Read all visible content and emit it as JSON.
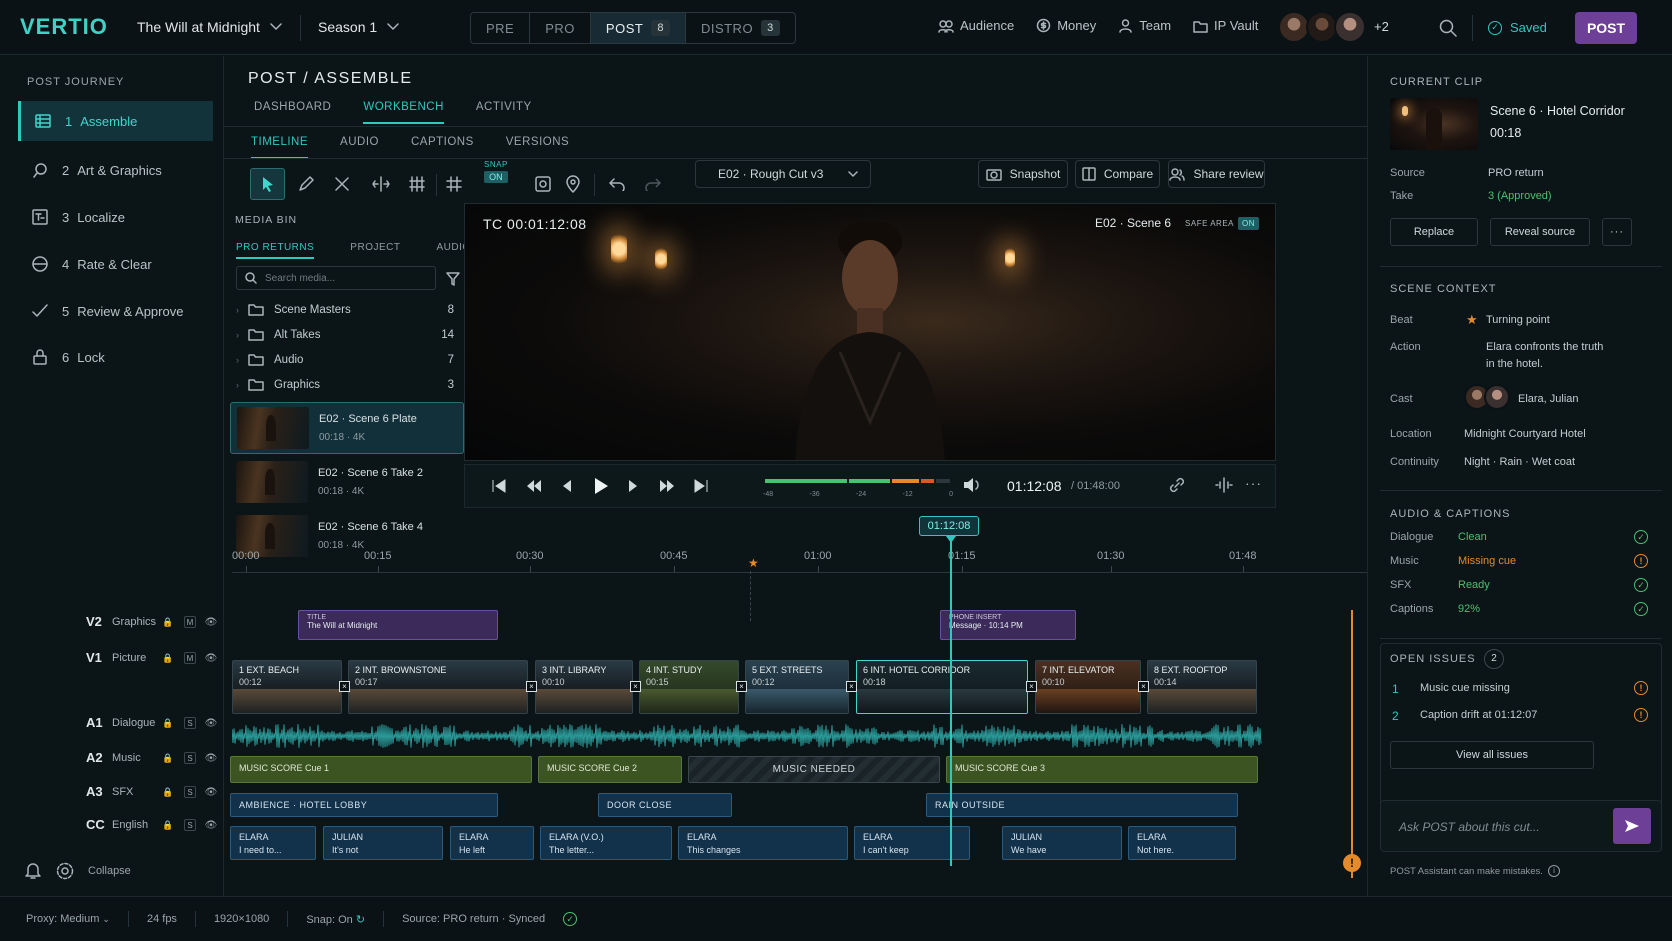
{
  "app": {
    "logo": "VERTIO",
    "project": "The Will at Midnight",
    "season": "Season 1"
  },
  "phases": [
    {
      "label": "PRE",
      "count": ""
    },
    {
      "label": "PRO",
      "count": ""
    },
    {
      "label": "POST",
      "count": "8"
    },
    {
      "label": "DISTRO",
      "count": "3"
    }
  ],
  "nav": {
    "audience": "Audience",
    "money": "Money",
    "team": "Team",
    "ipvault": "IP Vault",
    "more_people": "+2",
    "saved": "Saved",
    "post": "POST"
  },
  "left": {
    "heading": "POST JOURNEY",
    "items": [
      {
        "num": "1",
        "label": "Assemble"
      },
      {
        "num": "2",
        "label": "Art & Graphics"
      },
      {
        "num": "3",
        "label": "Localize"
      },
      {
        "num": "4",
        "label": "Rate & Clear"
      },
      {
        "num": "5",
        "label": "Review & Approve"
      },
      {
        "num": "6",
        "label": "Lock"
      }
    ],
    "collapse": "Collapse"
  },
  "center": {
    "breadcrumb": "POST  /  ASSEMBLE",
    "tabs": [
      "DASHBOARD",
      "WORKBENCH",
      "ACTIVITY"
    ],
    "subtabs": [
      "TIMELINE",
      "AUDIO",
      "CAPTIONS",
      "VERSIONS"
    ],
    "snap": {
      "label": "SNAP",
      "state": "ON"
    },
    "cut": "E02  ·  Rough Cut v3",
    "snapshot": "Snapshot",
    "compare": "Compare",
    "share": "Share review"
  },
  "mediabin": {
    "title": "MEDIA BIN",
    "tabs": [
      "PRO RETURNS",
      "PROJECT",
      "AUDIO"
    ],
    "search_placeholder": "Search media...",
    "folders": [
      {
        "name": "Scene Masters",
        "count": "8"
      },
      {
        "name": "Alt Takes",
        "count": "14"
      },
      {
        "name": "Audio",
        "count": "7"
      },
      {
        "name": "Graphics",
        "count": "3"
      }
    ],
    "clips": [
      {
        "name": "E02  ·  Scene 6 Plate",
        "meta": "00:18  ·  4K"
      },
      {
        "name": "E02  ·  Scene 6 Take 2",
        "meta": "00:18  ·  4K"
      },
      {
        "name": "E02  ·  Scene 6 Take 4",
        "meta": "00:18  ·  4K"
      }
    ]
  },
  "viewer": {
    "tc": "TC  00:01:12:08",
    "scene": "E02  ·  Scene 6",
    "safe": "SAFE AREA",
    "safe_state": "ON"
  },
  "transport": {
    "current": "01:12:08",
    "total": "/  01:48:00",
    "meter": [
      "-48",
      "-36",
      "-24",
      "-12",
      "0"
    ]
  },
  "timeline": {
    "playhead": "01:12:08",
    "ruler": [
      "00:00",
      "00:15",
      "00:30",
      "00:45",
      "01:00",
      "01:15",
      "01:30",
      "01:48"
    ],
    "tracks": [
      {
        "id": "V2",
        "name": "Graphics",
        "btn": "M"
      },
      {
        "id": "V1",
        "name": "Picture",
        "btn": "M"
      },
      {
        "id": "A1",
        "name": "Dialogue",
        "btn": "S"
      },
      {
        "id": "A2",
        "name": "Music",
        "btn": "S"
      },
      {
        "id": "A3",
        "name": "SFX",
        "btn": "S"
      },
      {
        "id": "CC",
        "name": "English",
        "btn": "S"
      }
    ],
    "graphics": [
      {
        "title": "TITLE",
        "sub": "The Will at Midnight"
      },
      {
        "title": "PHONE INSERT",
        "sub": "Message  ·  10:14 PM"
      }
    ],
    "picture": [
      {
        "name": "1 EXT. BEACH",
        "dur": "00:12"
      },
      {
        "name": "2 INT. BROWNSTONE",
        "dur": "00:17"
      },
      {
        "name": "3 INT. LIBRARY",
        "dur": "00:10"
      },
      {
        "name": "4 INT. STUDY",
        "dur": "00:15"
      },
      {
        "name": "5 EXT. STREETS",
        "dur": "00:12"
      },
      {
        "name": "6 INT. HOTEL CORRIDOR",
        "dur": "00:18"
      },
      {
        "name": "7 INT. ELEVATOR",
        "dur": "00:10"
      },
      {
        "name": "8 EXT. ROOFTOP",
        "dur": "00:14"
      }
    ],
    "music": [
      "MUSIC SCORE Cue 1",
      "MUSIC SCORE Cue 2",
      "MUSIC NEEDED",
      "MUSIC SCORE Cue 3"
    ],
    "sfx": [
      "AMBIENCE  ·  HOTEL LOBBY",
      "DOOR CLOSE",
      "RAIN OUTSIDE"
    ],
    "captions": [
      {
        "who": "ELARA",
        "line": "I need to..."
      },
      {
        "who": "JULIAN",
        "line": "It's not"
      },
      {
        "who": "ELARA",
        "line": "He left"
      },
      {
        "who": "ELARA (V.O.)",
        "line": "The letter..."
      },
      {
        "who": "ELARA",
        "line": "This changes"
      },
      {
        "who": "ELARA",
        "line": "I can't keep"
      },
      {
        "who": "JULIAN",
        "line": "We have"
      },
      {
        "who": "ELARA",
        "line": "Not here."
      }
    ]
  },
  "right": {
    "current_clip": "CURRENT CLIP",
    "clip_title": "Scene 6  ·  Hotel Corridor",
    "clip_dur": "00:18",
    "source_label": "Source",
    "source": "PRO return",
    "take_label": "Take",
    "take": "3 (Approved)",
    "replace": "Replace",
    "reveal": "Reveal source",
    "scene_context": "SCENE CONTEXT",
    "beat_label": "Beat",
    "beat": "Turning point",
    "action_label": "Action",
    "action1": "Elara confronts the truth",
    "action2": "in the hotel.",
    "cast_label": "Cast",
    "cast": "Elara, Julian",
    "location_label": "Location",
    "location": "Midnight Courtyard Hotel",
    "continuity_label": "Continuity",
    "continuity": "Night  ·  Rain  ·  Wet coat",
    "audio_caps": "AUDIO & CAPTIONS",
    "ac": [
      {
        "label": "Dialogue",
        "value": "Clean",
        "color": "#4cc06e"
      },
      {
        "label": "Music",
        "value": "Missing cue",
        "color": "#e58a2a"
      },
      {
        "label": "SFX",
        "value": "Ready",
        "color": "#4cc06e"
      },
      {
        "label": "Captions",
        "value": "92%",
        "color": "#4cc06e"
      }
    ],
    "open_issues": "OPEN ISSUES",
    "issues_count": "2",
    "issues": [
      {
        "num": "1",
        "text": "Music cue missing"
      },
      {
        "num": "2",
        "text": "Caption drift at 01:12:07"
      }
    ],
    "view_all": "View all issues",
    "ask_placeholder": "Ask POST about this cut...",
    "disclaimer": "POST Assistant can make mistakes."
  },
  "status": {
    "proxy": "Proxy: Medium",
    "fps": "24 fps",
    "res": "1920×1080",
    "snap": "Snap: On",
    "source": "Source: PRO return  ·  Synced"
  },
  "colors": {
    "accent": "#2fc8c0",
    "post": "#6d3f96",
    "warn": "#e58a2a",
    "ok": "#4cc06e"
  }
}
